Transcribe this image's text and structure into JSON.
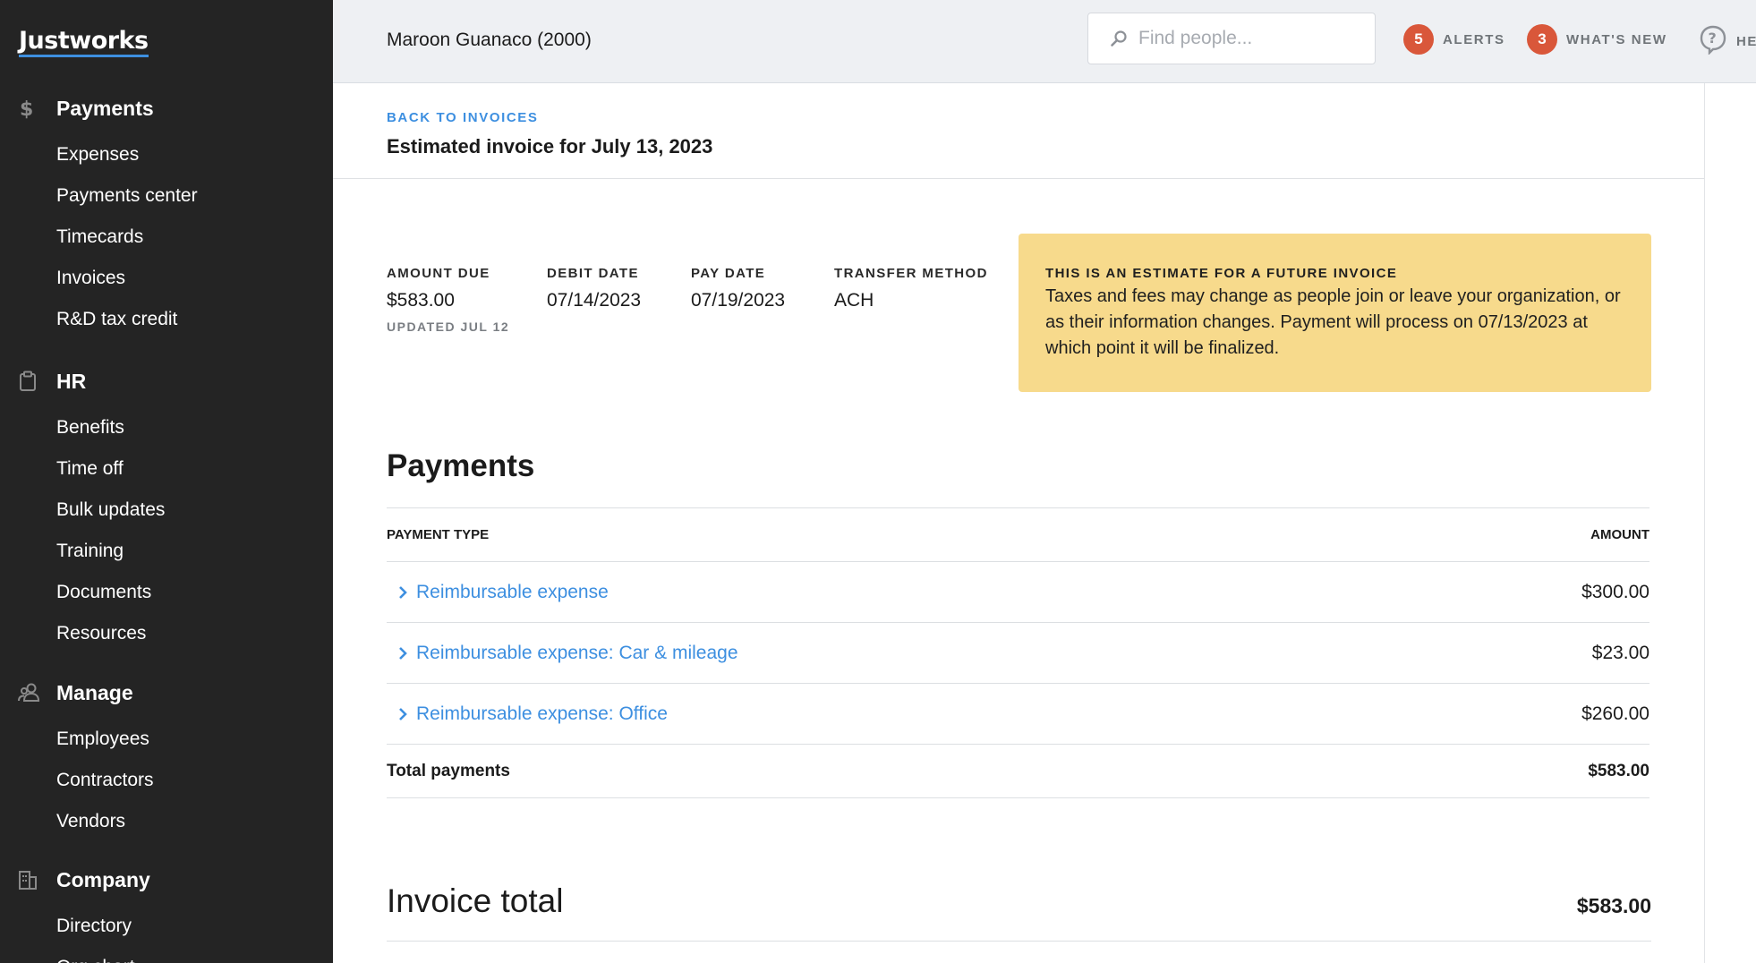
{
  "brand": {
    "logo_text": "Justworks"
  },
  "sidebar": {
    "sections": [
      {
        "icon": "dollar-icon",
        "title": "Payments",
        "items": [
          "Expenses",
          "Payments center",
          "Timecards",
          "Invoices",
          "R&D tax credit"
        ]
      },
      {
        "icon": "clipboard-icon",
        "title": "HR",
        "items": [
          "Benefits",
          "Time off",
          "Bulk updates",
          "Training",
          "Documents",
          "Resources"
        ]
      },
      {
        "icon": "people-icon",
        "title": "Manage",
        "items": [
          "Employees",
          "Contractors",
          "Vendors"
        ]
      },
      {
        "icon": "building-icon",
        "title": "Company",
        "items": [
          "Directory",
          "Org chart"
        ]
      }
    ]
  },
  "topbar": {
    "company": "Maroon Guanaco (2000)",
    "search_placeholder": "Find people...",
    "alerts": {
      "count": "5",
      "label": "ALERTS"
    },
    "whats_new": {
      "count": "3",
      "label": "WHAT'S NEW"
    },
    "help": {
      "label": "HELP"
    }
  },
  "page": {
    "back_link": "BACK TO INVOICES",
    "title": "Estimated invoice for July 13, 2023"
  },
  "summary": {
    "amount_due": {
      "label": "AMOUNT DUE",
      "value": "$583.00",
      "sub": "UPDATED JUL 12"
    },
    "debit_date": {
      "label": "DEBIT DATE",
      "value": "07/14/2023"
    },
    "pay_date": {
      "label": "PAY DATE",
      "value": "07/19/2023"
    },
    "transfer_method": {
      "label": "TRANSFER METHOD",
      "value": "ACH"
    }
  },
  "notice": {
    "title": "THIS IS AN ESTIMATE FOR A FUTURE INVOICE",
    "body": "Taxes and fees may change as people join or leave your organization, or as their information changes. Payment will process on 07/13/2023 at which point it will be finalized."
  },
  "payments": {
    "title": "Payments",
    "col_type": "PAYMENT TYPE",
    "col_amount": "AMOUNT",
    "rows": [
      {
        "type": "Reimbursable expense",
        "amount": "$300.00"
      },
      {
        "type": "Reimbursable expense: Car & mileage",
        "amount": "$23.00"
      },
      {
        "type": "Reimbursable expense: Office",
        "amount": "$260.00"
      }
    ],
    "total_label": "Total payments",
    "total_value": "$583.00"
  },
  "invoice_total": {
    "label": "Invoice total",
    "value": "$583.00"
  },
  "colors": {
    "accent": "#3d8fe0",
    "badge": "#d9573a",
    "notice_bg": "#f7da8c",
    "sidebar_bg": "#242424"
  }
}
